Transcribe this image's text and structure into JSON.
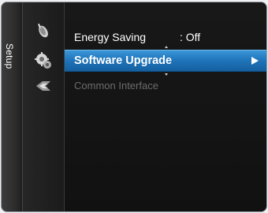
{
  "side_tab": {
    "label": "Setup"
  },
  "icons": [
    "satellite-dish-icon",
    "gear-icon",
    "common-interface-icon"
  ],
  "menu": {
    "items": [
      {
        "label": "Energy Saving",
        "value": ": Off",
        "state": "normal"
      },
      {
        "label": "Software Upgrade",
        "value": "",
        "state": "selected"
      },
      {
        "label": "Common Interface",
        "value": "",
        "state": "disabled"
      }
    ]
  },
  "colors": {
    "highlight": "#1f73b8",
    "background": "#141414",
    "disabled_text": "#6c6c6c"
  }
}
